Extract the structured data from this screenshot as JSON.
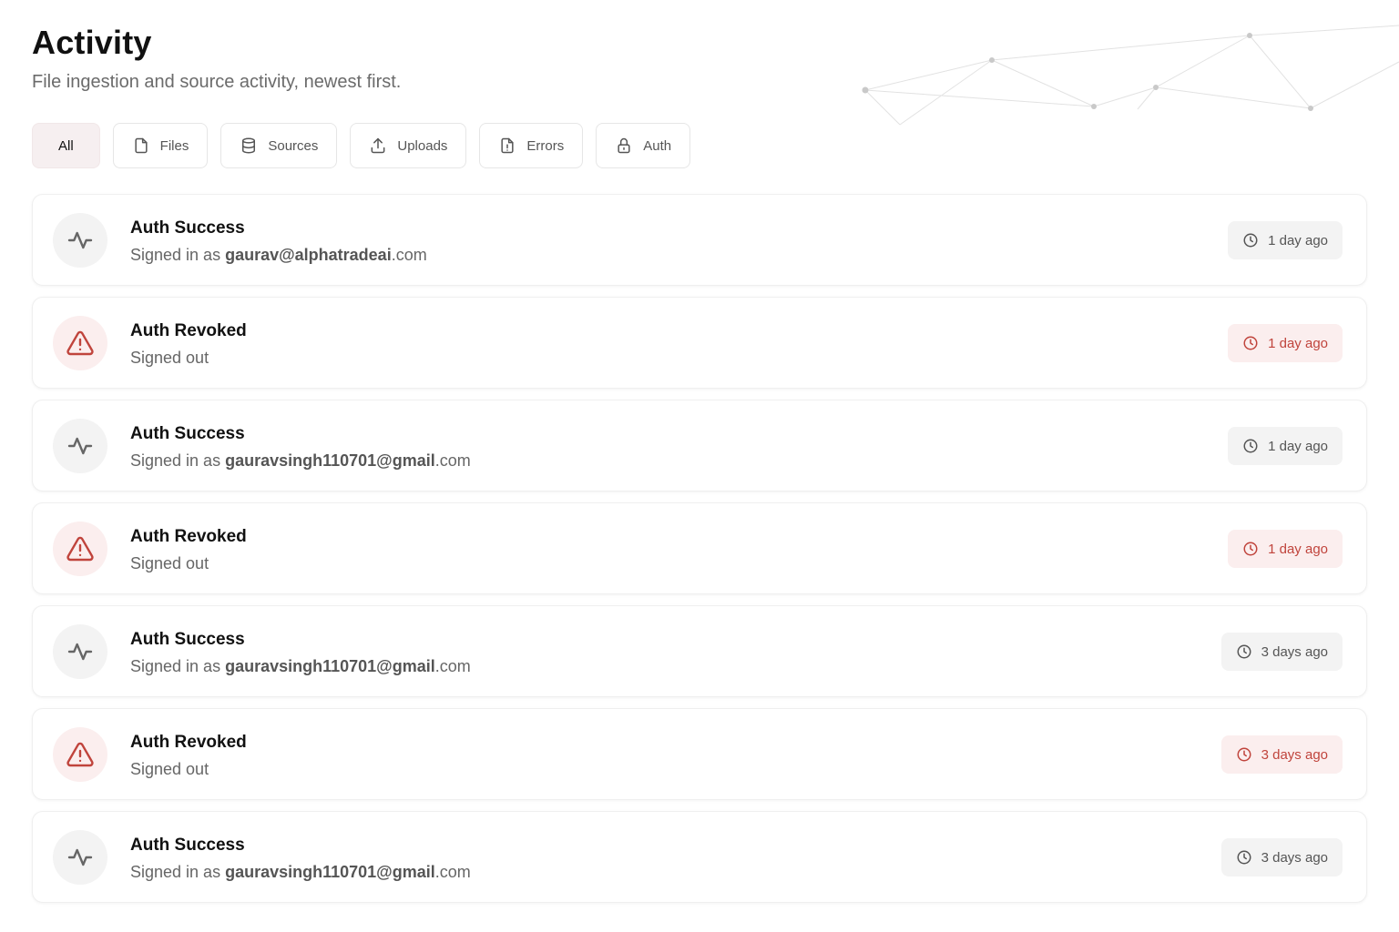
{
  "header": {
    "title": "Activity",
    "subtitle": "File ingestion and source activity, newest first."
  },
  "filters": [
    {
      "label": "All",
      "icon": "none",
      "active": true
    },
    {
      "label": "Files",
      "icon": "file-icon",
      "active": false
    },
    {
      "label": "Sources",
      "icon": "database-icon",
      "active": false
    },
    {
      "label": "Uploads",
      "icon": "upload-icon",
      "active": false
    },
    {
      "label": "Errors",
      "icon": "file-alert-icon",
      "active": false
    },
    {
      "label": "Auth",
      "icon": "lock-icon",
      "active": false
    }
  ],
  "events": [
    {
      "type": "success",
      "icon": "activity-icon",
      "title": "Auth Success",
      "prefix": "Signed in as",
      "user": "gaurav@alphatradeai",
      "suffix": ".com",
      "time": "1 day ago"
    },
    {
      "type": "revoked",
      "icon": "warning-triangle-icon",
      "title": "Auth Revoked",
      "prefix": "Signed out",
      "user": "",
      "suffix": "",
      "time": "1 day ago"
    },
    {
      "type": "success",
      "icon": "activity-icon",
      "title": "Auth Success",
      "prefix": "Signed in as",
      "user": "gauravsingh110701@gmail",
      "suffix": ".com",
      "time": "1 day ago"
    },
    {
      "type": "revoked",
      "icon": "warning-triangle-icon",
      "title": "Auth Revoked",
      "prefix": "Signed out",
      "user": "",
      "suffix": "",
      "time": "1 day ago"
    },
    {
      "type": "success",
      "icon": "activity-icon",
      "title": "Auth Success",
      "prefix": "Signed in as",
      "user": "gauravsingh110701@gmail",
      "suffix": ".com",
      "time": "3 days ago"
    },
    {
      "type": "revoked",
      "icon": "warning-triangle-icon",
      "title": "Auth Revoked",
      "prefix": "Signed out",
      "user": "",
      "suffix": "",
      "time": "3 days ago"
    },
    {
      "type": "success",
      "icon": "activity-icon",
      "title": "Auth Success",
      "prefix": "Signed in as",
      "user": "gauravsingh110701@gmail",
      "suffix": ".com",
      "time": "3 days ago"
    }
  ],
  "colors": {
    "accent_error": "#c0443c",
    "error_bg": "#fbeeee",
    "neutral_bg": "#f3f3f3",
    "active_filter_bg": "#f6eff0"
  }
}
